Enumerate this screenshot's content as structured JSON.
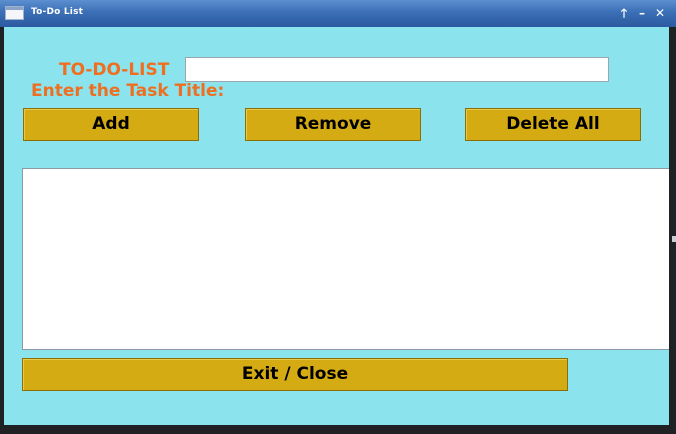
{
  "window": {
    "title": "To-Do List"
  },
  "titlebar": {
    "maximize_icon": "arrow-up-icon",
    "minimize_icon": "minimize-icon",
    "close_icon": "close-icon",
    "maximize_glyph": "🡑",
    "minimize_glyph": "–",
    "close_glyph": "✕"
  },
  "form": {
    "heading": "TO-DO-LIST",
    "task_label": "Enter the Task Title:",
    "task_input_value": "",
    "task_input_placeholder": ""
  },
  "actions": {
    "add_label": "Add",
    "remove_label": "Remove",
    "delete_all_label": "Delete All",
    "exit_label": "Exit / Close"
  },
  "task_list": {
    "items": []
  },
  "colors": {
    "client_background": "#8be4ed",
    "heading_color": "#ee6f21",
    "button_color": "#d4ab12",
    "titlebar_color": "#3b6fb6"
  }
}
